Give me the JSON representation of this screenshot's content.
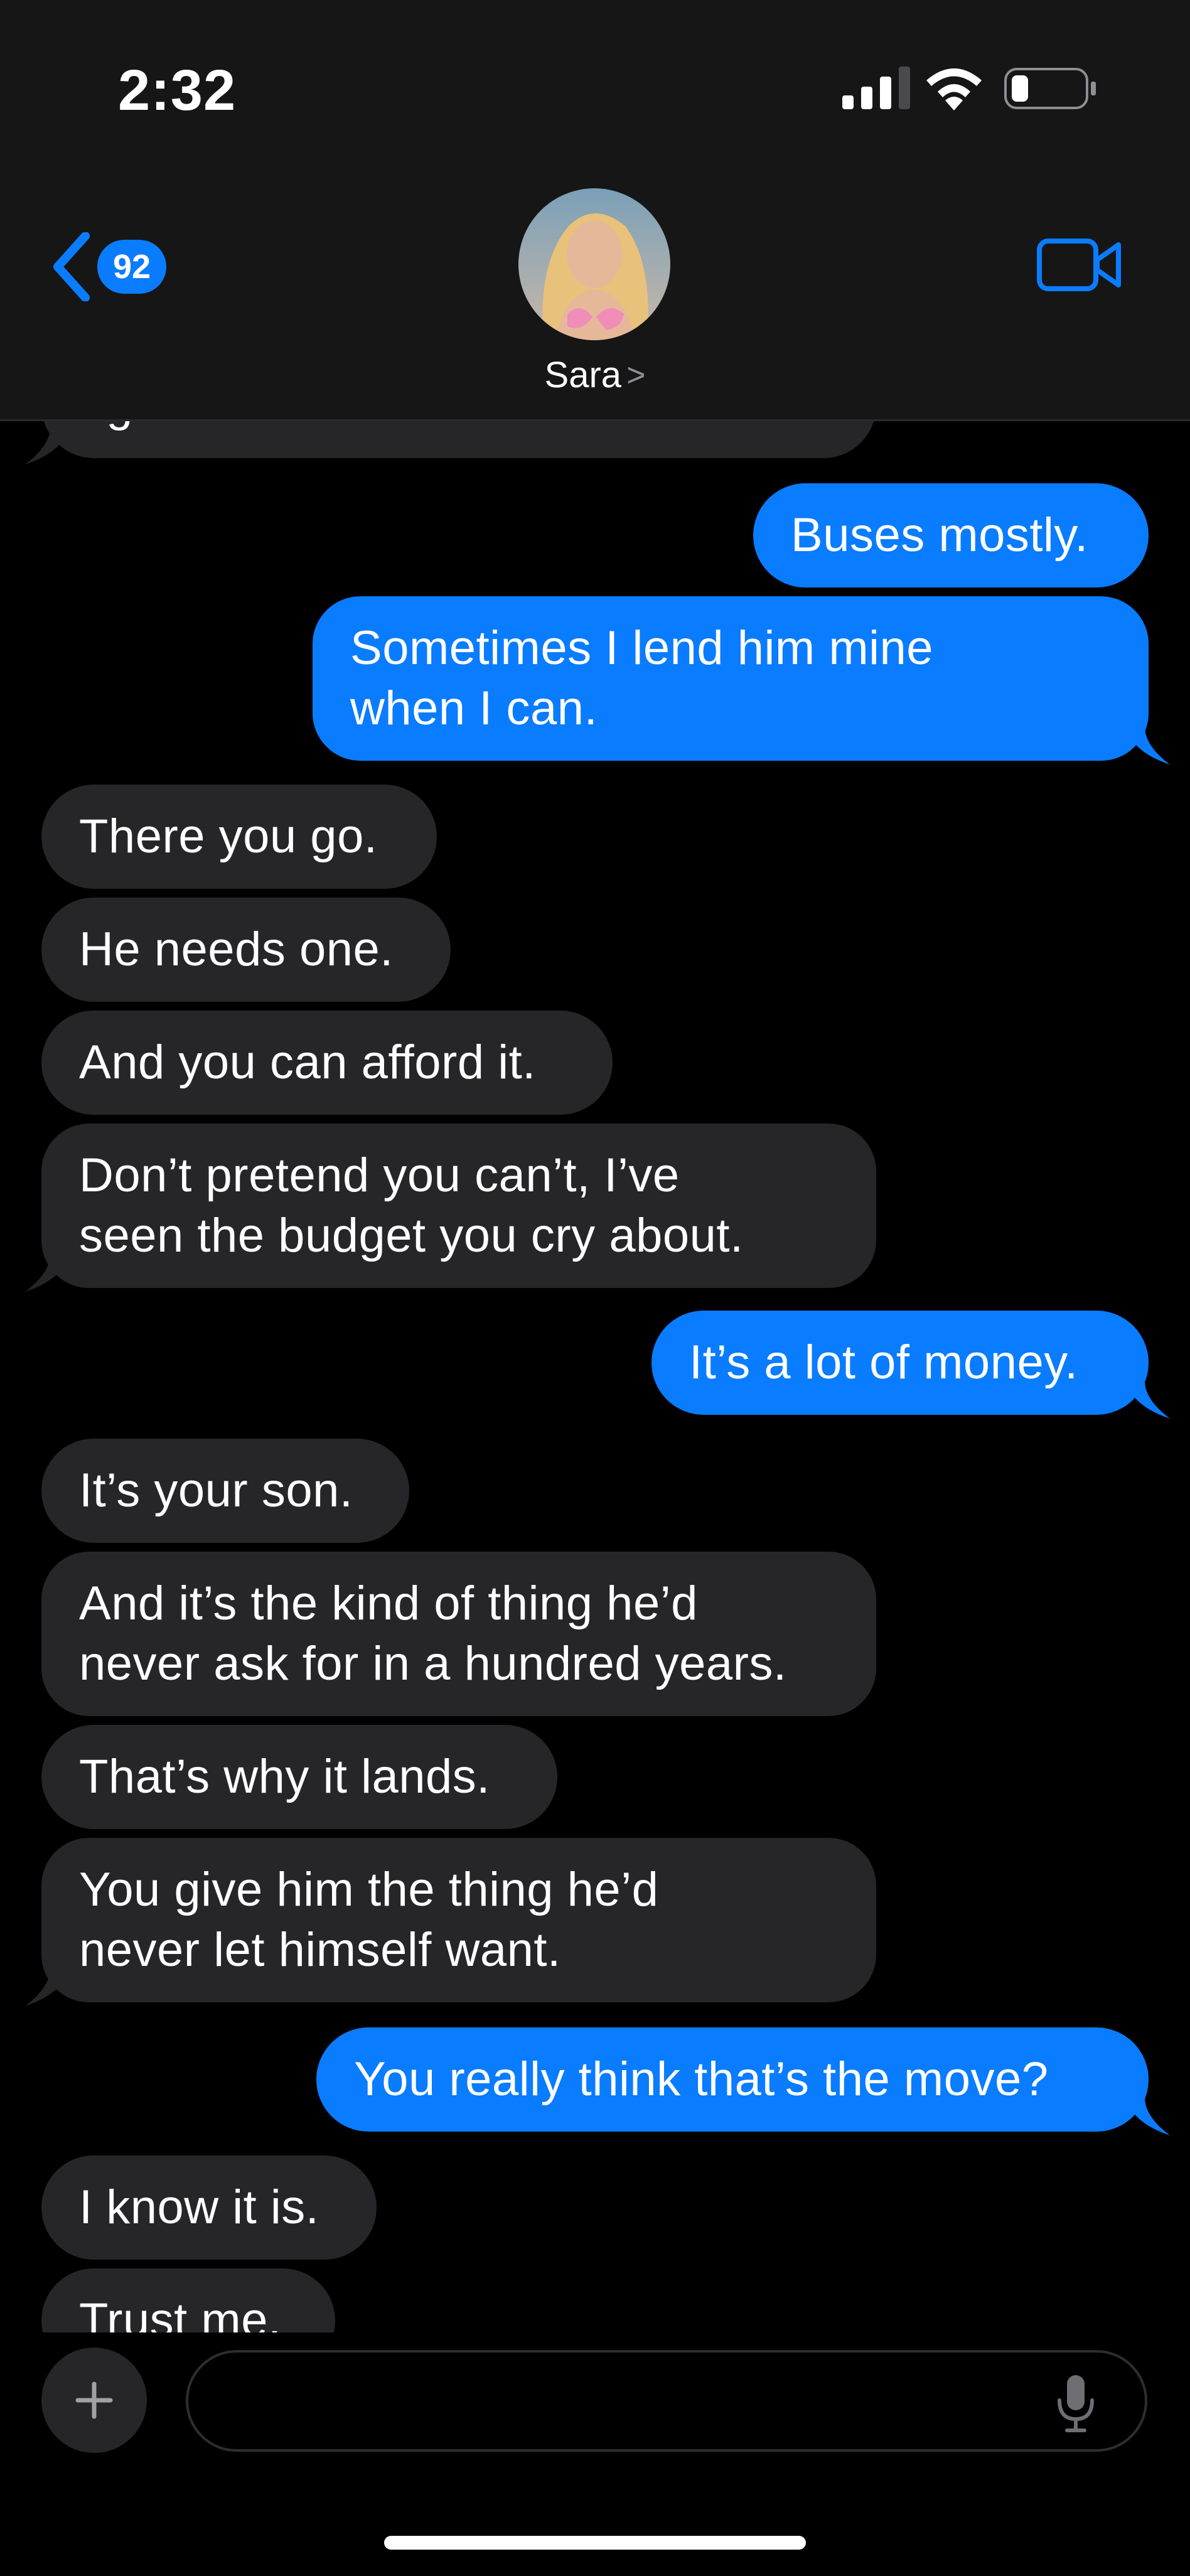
{
  "status_bar": {
    "time": "2:32",
    "icons": [
      "cellular-signal-icon",
      "wifi-icon",
      "battery-icon"
    ]
  },
  "header": {
    "back_badge_count": "92",
    "contact_name": "Sara",
    "contact_chevron": ">",
    "video_call_icon": "video-camera-icon",
    "back_icon": "chevron-left-icon"
  },
  "messages": [
    {
      "from": "them",
      "text": "right now?"
    },
    {
      "from": "me",
      "text": "Buses mostly."
    },
    {
      "from": "me",
      "text": "Sometimes I lend him mine\nwhen I can."
    },
    {
      "from": "them",
      "text": "There you go."
    },
    {
      "from": "them",
      "text": "He needs one."
    },
    {
      "from": "them",
      "text": "And you can afford it."
    },
    {
      "from": "them",
      "text": "Don’t pretend you can’t, I’ve\nseen the budget you cry about."
    },
    {
      "from": "me",
      "text": "It’s a lot of money."
    },
    {
      "from": "them",
      "text": "It’s your son."
    },
    {
      "from": "them",
      "text": "And it’s the kind of thing he’d\nnever ask for in a hundred years."
    },
    {
      "from": "them",
      "text": "That’s why it lands."
    },
    {
      "from": "them",
      "text": "You give him the thing he’d\nnever let himself want."
    },
    {
      "from": "me",
      "text": "You really think that’s the move?"
    },
    {
      "from": "them",
      "text": "I know it is."
    },
    {
      "from": "them",
      "text": "Trust me."
    }
  ],
  "composer": {
    "plus_label": "+",
    "input_value": "",
    "input_placeholder": "",
    "mic_icon": "microphone-icon"
  },
  "colors": {
    "outgoing_bubble": "#0a7cff",
    "incoming_bubble": "#262628",
    "header_background": "#161616",
    "background": "#000000"
  }
}
